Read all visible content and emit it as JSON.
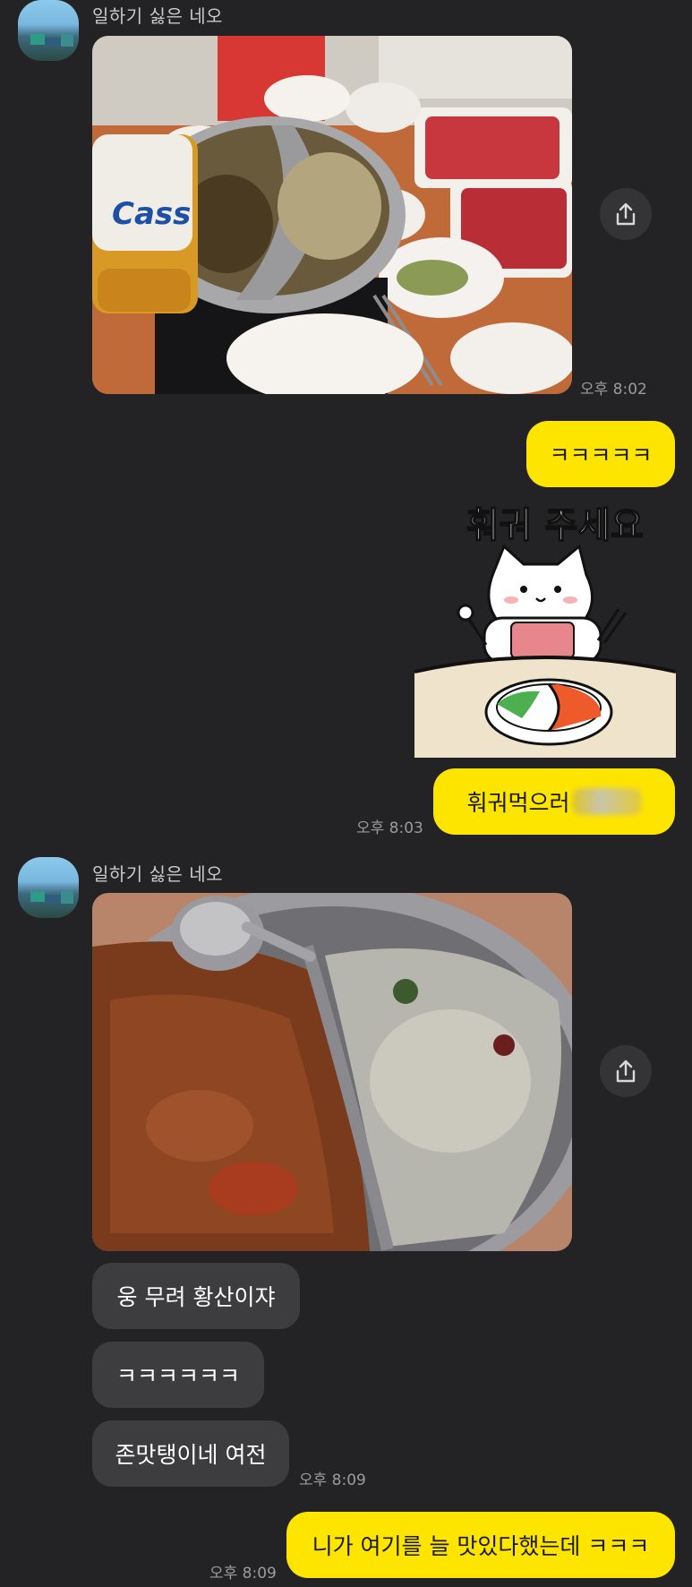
{
  "conversation": {
    "messages": [
      {
        "sender": "일하기 싫은 네오",
        "time": "오후 8:02"
      },
      {
        "text": "ㅋㅋㅋㅋㅋ"
      },
      {
        "sticker_text": "훠궈 주세요"
      },
      {
        "text": "훠궈먹으러",
        "time": "오후 8:03"
      },
      {
        "sender": "일하기 싫은 네오"
      },
      {
        "text": "웅 무려 황산이쟈"
      },
      {
        "text": "ㅋㅋㅋㅋㅋㅋ"
      },
      {
        "text": "존맛탱이네 여전",
        "time": "오후 8:09"
      },
      {
        "text": "니가 여기를 늘 맛있다했는데 ㅋㅋㅋ",
        "time": "오후 8:09"
      }
    ]
  },
  "photo1": {
    "beer_brand": "Cass"
  },
  "colors": {
    "background": "#232325",
    "outgoing_bubble": "#fee500",
    "incoming_bubble": "#3d3d40"
  },
  "icons": {
    "share": "share-icon"
  }
}
